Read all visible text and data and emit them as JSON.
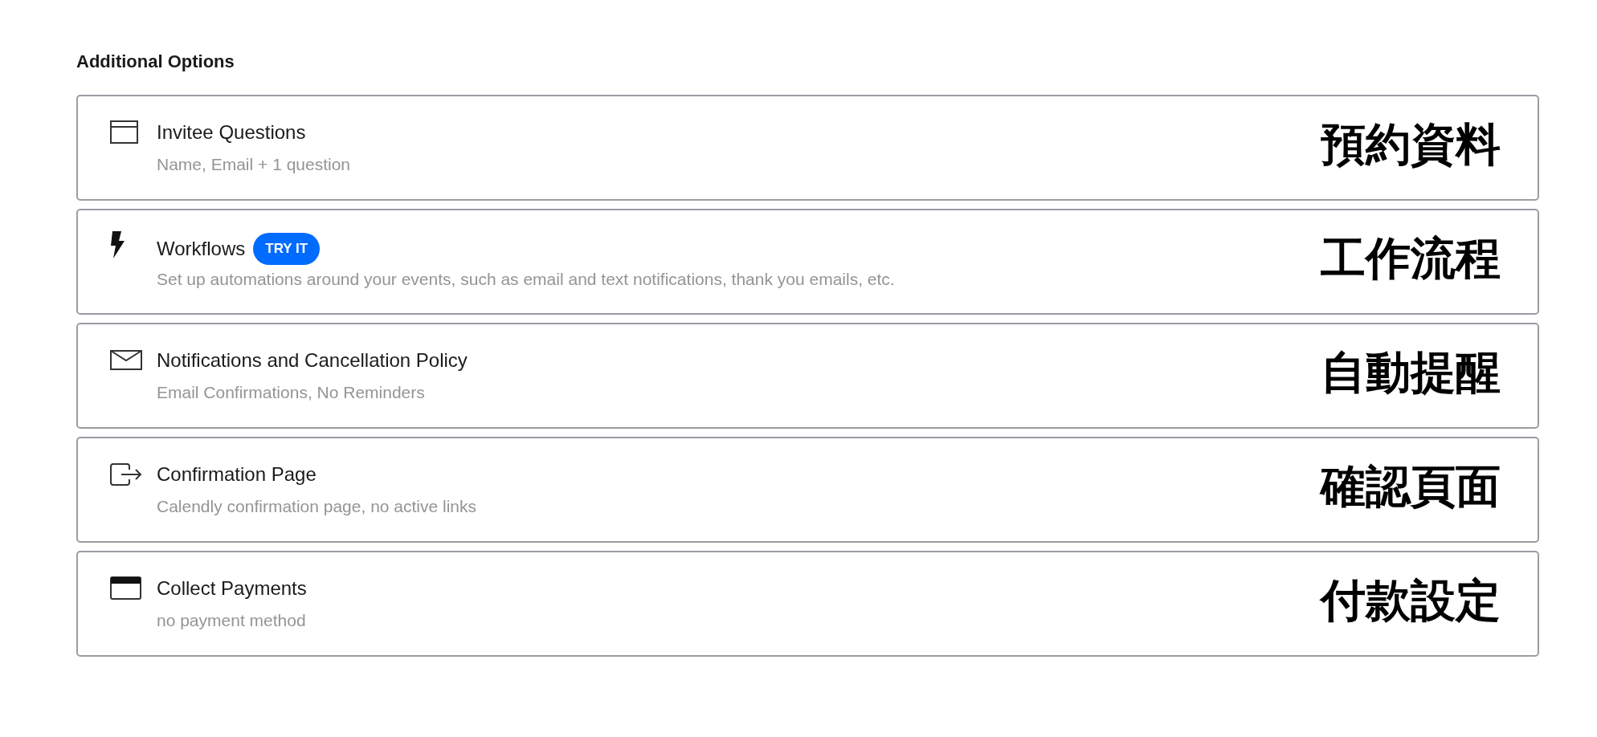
{
  "section": {
    "title": "Additional Options"
  },
  "options": [
    {
      "kind": "questions",
      "title": "Invitee Questions",
      "subtitle": "Name, Email + 1 question",
      "annotation": "預約資料"
    },
    {
      "kind": "workflows",
      "title": "Workflows",
      "badge": "TRY IT",
      "subtitle": "Set up automations around your events, such as email and text notifications, thank you emails, etc.",
      "annotation": "工作流程"
    },
    {
      "kind": "notifications",
      "title": "Notifications and Cancellation Policy",
      "subtitle": "Email Confirmations, No Reminders",
      "annotation": "自動提醒"
    },
    {
      "kind": "confirmation",
      "title": "Confirmation Page",
      "subtitle": "Calendly confirmation page, no active links",
      "annotation": "確認頁面"
    },
    {
      "kind": "payments",
      "title": "Collect Payments",
      "subtitle": "no payment method",
      "annotation": "付款設定"
    }
  ]
}
